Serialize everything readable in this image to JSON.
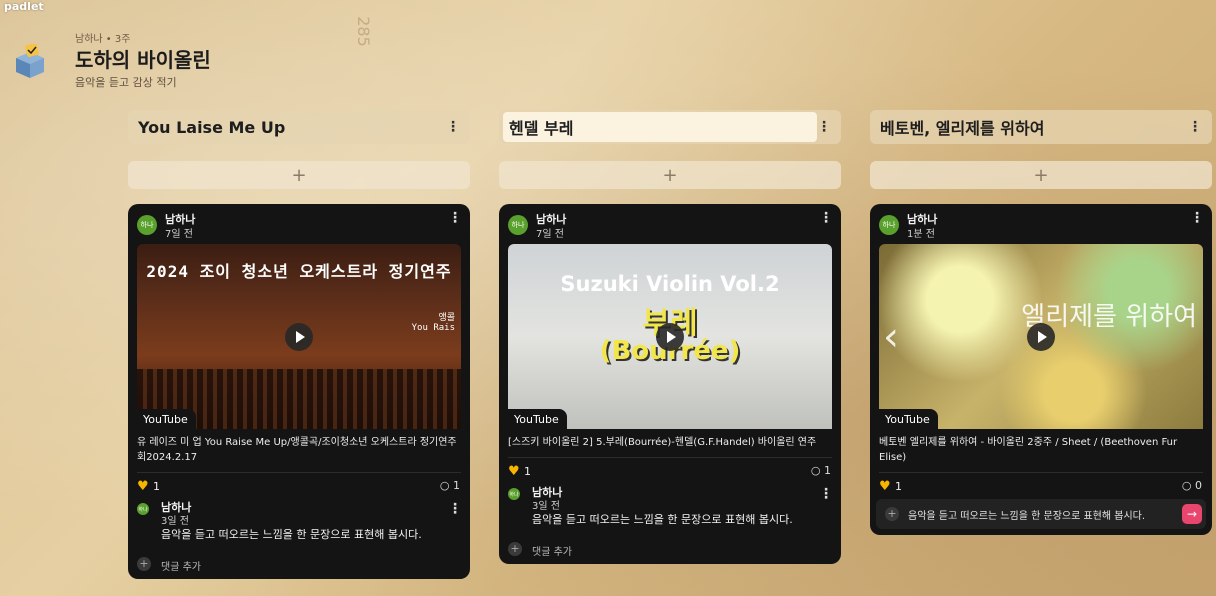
{
  "app": {
    "brand": "padlet"
  },
  "wall": {
    "meta": "남하나 • 3주",
    "title": "도하의 바이올린",
    "subtitle": "음악을 듣고 감상 적기",
    "bg_note": "285"
  },
  "add_symbol": "+",
  "menu_symbol": "⋮",
  "columns": [
    {
      "title": "You Laise Me Up",
      "post": {
        "author": "남하나",
        "avatar": "하나",
        "time": "7일 전",
        "thumb_text": "2024 조이 청소년 오케스트라 정기연주",
        "thumb_subtext": "앵콜\nYou Rais",
        "source": "YouTube",
        "description": "유 레이즈 미 업 You Raise Me Up/앵콜곡/조이청소년 오케스트라 정기연주회2024.2.17",
        "likes": "1",
        "comments": "1",
        "comment": {
          "author": "남하나",
          "avatar": "하나",
          "time": "3일 전",
          "text": "음악을 듣고 떠오르는 느낌을 한 문장으로 표현해 봅시다."
        },
        "add_comment": "댓글 추가"
      }
    },
    {
      "title": "헨델 부레",
      "post": {
        "author": "남하나",
        "avatar": "하나",
        "time": "7일 전",
        "thumb_text": "Suzuki Violin Vol.2",
        "thumb_subtext": "부레",
        "thumb_subtext2": "(Bourrée)",
        "source": "YouTube",
        "description": "[스즈키 바이올린 2] 5.부레(Bourrée)-헨델(G.F.Handel) 바이올린 연주",
        "likes": "1",
        "comments": "1",
        "comment": {
          "author": "남하나",
          "avatar": "하나",
          "time": "3일 전",
          "text": "음악을 듣고 떠오르는 느낌을 한 문장으로 표현해 봅시다."
        },
        "add_comment": "댓글 추가"
      }
    },
    {
      "title": "베토벤, 엘리제를 위하여",
      "post": {
        "author": "남하나",
        "avatar": "하나",
        "time": "1분 전",
        "thumb_text": "엘리제를 위하여",
        "source": "YouTube",
        "description": "베토벤 엘리제를 위하여 - 바이올린 2중주 / Sheet / (Beethoven Fur Elise)",
        "likes": "1",
        "comments": "0",
        "input_placeholder": "음악을 듣고 떠오르는 느낌을 한 문장으로 표현해 봅시다.",
        "send_icon": "→"
      }
    }
  ],
  "colors": {
    "card_bg": "#141414",
    "heart": "#f7b500",
    "send": "#e8456f",
    "avatar": "#5aa02c"
  }
}
